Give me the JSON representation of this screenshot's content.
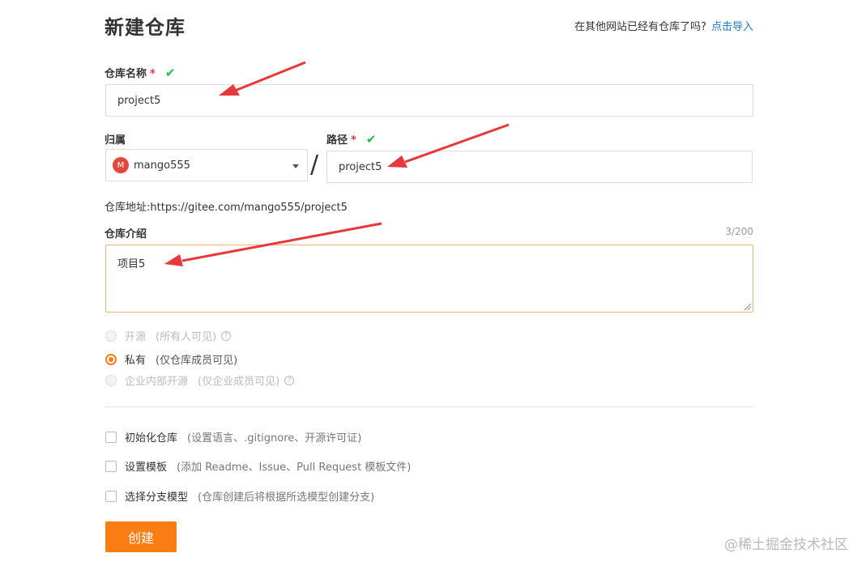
{
  "header": {
    "title": "新建仓库",
    "import_prompt": "在其他网站已经有仓库了吗?",
    "import_link": "点击导入"
  },
  "form": {
    "name_label": "仓库名称",
    "required_mark": "*",
    "check_glyph": "✔",
    "name_value": "project5",
    "owner_label": "归属",
    "owner_avatar_letter": "M",
    "owner_value": "mango555",
    "path_label": "路径",
    "path_value": "project5",
    "slash": "/",
    "address_text": "仓库地址:https://gitee.com/mango555/project5",
    "intro_label": "仓库介绍",
    "intro_count": "3/200",
    "intro_value": "项目5",
    "visibility": [
      {
        "label": "开源",
        "note": "(所有人可见)",
        "state": "disabled",
        "help": "?"
      },
      {
        "label": "私有",
        "note": "(仅仓库成员可见)",
        "state": "selected"
      },
      {
        "label": "企业内部开源",
        "note": "(仅企业成员可见)",
        "state": "disabled",
        "help": "?"
      }
    ],
    "options": [
      {
        "label": "初始化仓库",
        "note": "(设置语言、.gitignore、开源许可证)"
      },
      {
        "label": "设置模板",
        "note": "(添加 Readme、Issue、Pull Request 模板文件)"
      },
      {
        "label": "选择分支模型",
        "note": "(仓库创建后将根据所选模型创建分支)"
      }
    ],
    "submit_label": "创建"
  },
  "watermark": "@稀土掘金技术社区",
  "colors": {
    "accent": "#fa7d14",
    "link": "#1f7ac8",
    "check": "#21ba45",
    "required": "#e33333",
    "arrow": "#e8383b"
  }
}
